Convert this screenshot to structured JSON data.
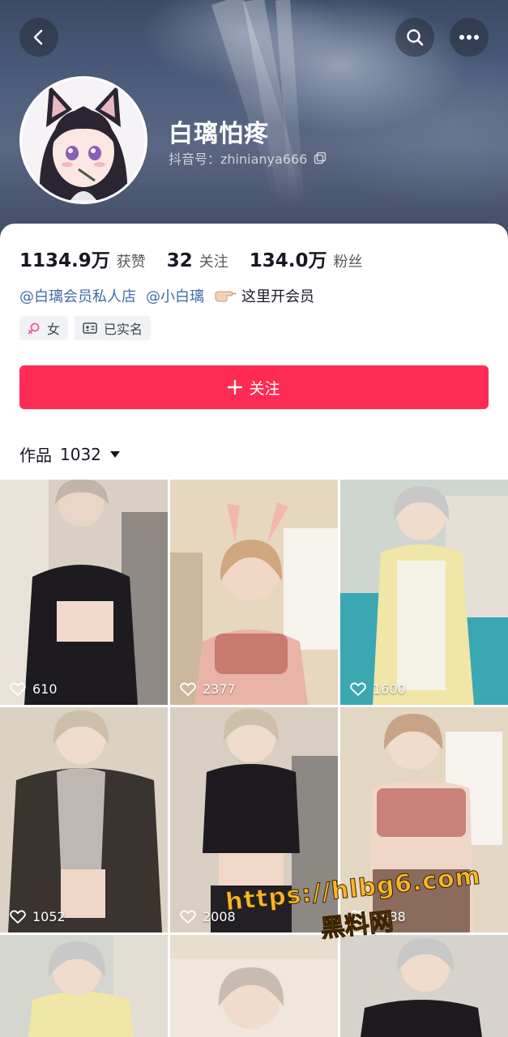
{
  "profile": {
    "nickname": "白璃怕疼",
    "douyin_id_label": "抖音号：",
    "douyin_id": "zhinianya666"
  },
  "stats": [
    {
      "value": "1134.9万",
      "label": "获赞"
    },
    {
      "value": "32",
      "label": "关注"
    },
    {
      "value": "134.0万",
      "label": "粉丝"
    }
  ],
  "bio": {
    "mention1": "@白璃会员私人店",
    "mention2": "@小白璃",
    "text": "这里开会员"
  },
  "tags": {
    "gender": "女",
    "verified": "已实名"
  },
  "follow_button": {
    "label": "关注"
  },
  "works": {
    "label": "作品",
    "count": "1032"
  },
  "videos": [
    {
      "likes": "610"
    },
    {
      "likes": "2377"
    },
    {
      "likes": "1600"
    },
    {
      "likes": "1052"
    },
    {
      "likes": "2008"
    },
    {
      "likes": "4488"
    },
    {
      "likes": ""
    },
    {
      "likes": ""
    },
    {
      "likes": ""
    }
  ],
  "watermark": {
    "url": "https://hlbg6.com",
    "text": "黑料网"
  },
  "colors": {
    "accent": "#fe2c55",
    "mention": "#3f6ba8"
  }
}
